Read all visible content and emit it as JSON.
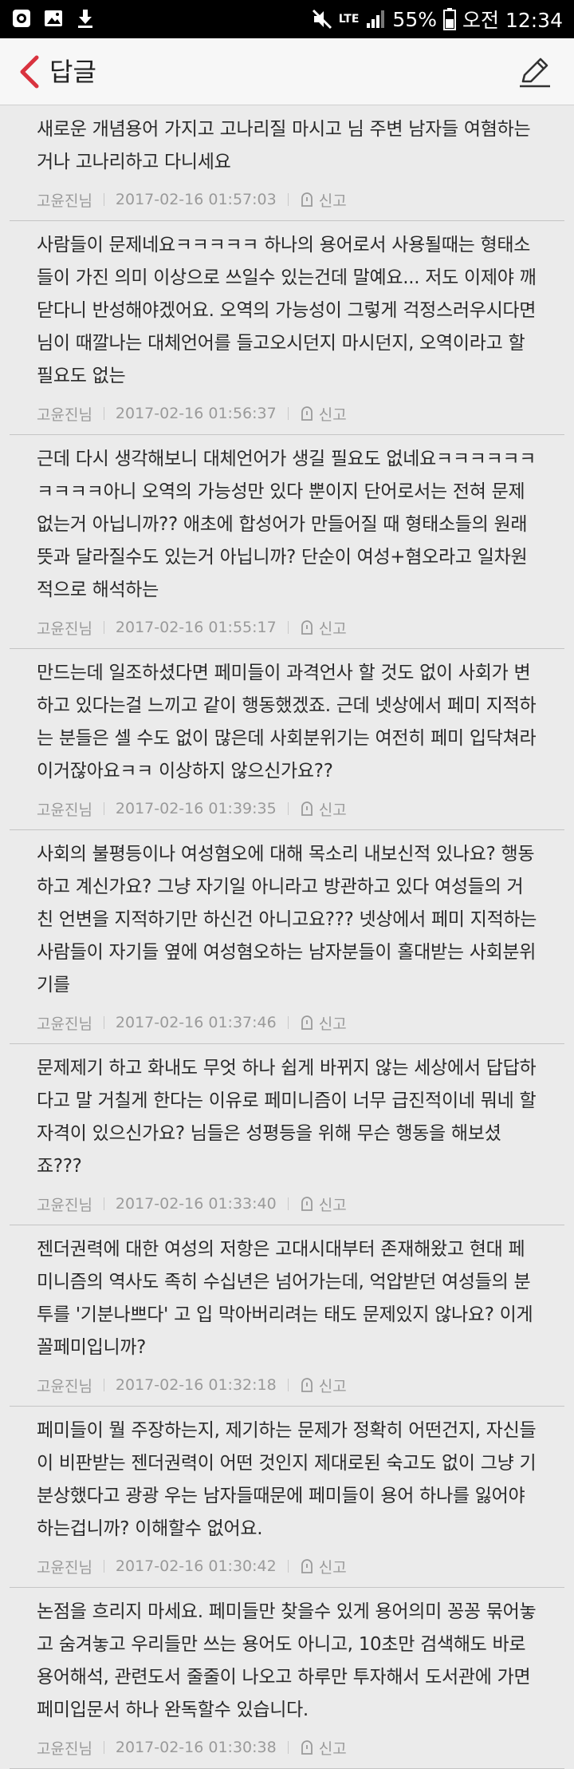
{
  "status": {
    "lte": "LTE",
    "battery": "55%",
    "time": "오전 12:34"
  },
  "header": {
    "title": "답글"
  },
  "report_label": "신고",
  "comments": [
    {
      "author": "고윤진님",
      "date": "2017-02-16 01:57:03",
      "text": "새로운 개념용어 가지고 고나리질 마시고 님 주변 남자들 여혐하는거나 고나리하고 다니세요"
    },
    {
      "author": "고윤진님",
      "date": "2017-02-16 01:56:37",
      "text": "사람들이 문제네요ㅋㅋㅋㅋㅋ 하나의 용어로서 사용될때는 형태소들이 가진 의미 이상으로 쓰일수 있는건데 말예요... 저도 이제야 깨닫다니 반성해야겠어요. 오역의 가능성이 그렇게 걱정스러우시다면 님이 때깔나는 대체언어를 들고오시던지 마시던지, 오역이라고 할 필요도 없는"
    },
    {
      "author": "고윤진님",
      "date": "2017-02-16 01:55:17",
      "text": "근데 다시 생각해보니 대체언어가 생길 필요도 없네요ㅋㅋㅋㅋㅋㅋㅋㅋㅋㅋ아니 오역의 가능성만 있다 뿐이지 단어로서는 전혀 문제없는거 아닙니까?? 애초에 합성어가 만들어질 때 형태소들의 원래 뜻과 달라질수도 있는거 아닙니까? 단순이 여성+혐오라고 일차원적으로 해석하는"
    },
    {
      "author": "고윤진님",
      "date": "2017-02-16 01:39:35",
      "text": "만드는데 일조하셨다면 페미들이 과격언사 할 것도 없이 사회가 변하고 있다는걸 느끼고 같이 행동했겠죠. 근데 넷상에서 페미 지적하는 분들은 셀 수도 없이 많은데 사회분위기는 여전히 페미 입닥쳐라 이거잖아요ㅋㅋ 이상하지 않으신가요??"
    },
    {
      "author": "고윤진님",
      "date": "2017-02-16 01:37:46",
      "text": "사회의 불평등이나 여성혐오에 대해 목소리 내보신적 있나요? 행동하고 계신가요? 그냥 자기일 아니라고 방관하고 있다 여성들의 거친 언변을 지적하기만 하신건 아니고요??? 넷상에서 페미 지적하는 사람들이 자기들 옆에 여성혐오하는 남자분들이 홀대받는 사회분위기를"
    },
    {
      "author": "고윤진님",
      "date": "2017-02-16 01:33:40",
      "text": "문제제기 하고 화내도 무엇 하나 쉽게 바뀌지 않는 세상에서 답답하다고 말 거칠게 한다는 이유로 페미니즘이 너무 급진적이네 뭐네 할 자격이 있으신가요? 님들은 성평등을 위해 무슨 행동을 해보셨죠???"
    },
    {
      "author": "고윤진님",
      "date": "2017-02-16 01:32:18",
      "text": "젠더권력에 대한 여성의 저항은 고대시대부터 존재해왔고 현대 페미니즘의 역사도 족히 수십년은 넘어가는데, 억압받던 여성들의 분투를 '기분나쁘다' 고 입 막아버리려는 태도 문제있지 않나요? 이게 꼴페미입니까?"
    },
    {
      "author": "고윤진님",
      "date": "2017-02-16 01:30:42",
      "text": "페미들이 뭘 주장하는지, 제기하는 문제가 정확히 어떤건지, 자신들이 비판받는 젠더권력이 어떤 것인지 제대로된 숙고도 없이 그냥 기분상했다고 광광 우는 남자들때문에 페미들이 용어 하나를 잃어야 하는겁니까? 이해할수 없어요."
    },
    {
      "author": "고윤진님",
      "date": "2017-02-16 01:30:38",
      "text": "논점을 흐리지 마세요. 페미들만 찾을수 있게 용어의미 꽁꽁 묶어놓고 숨겨놓고 우리들만 쓰는 용어도 아니고, 10초만 검색해도 바로 용어해석, 관련도서 줄줄이 나오고 하루만 투자해서 도서관에 가면 페미입문서 하나 완독할수 있습니다."
    }
  ]
}
